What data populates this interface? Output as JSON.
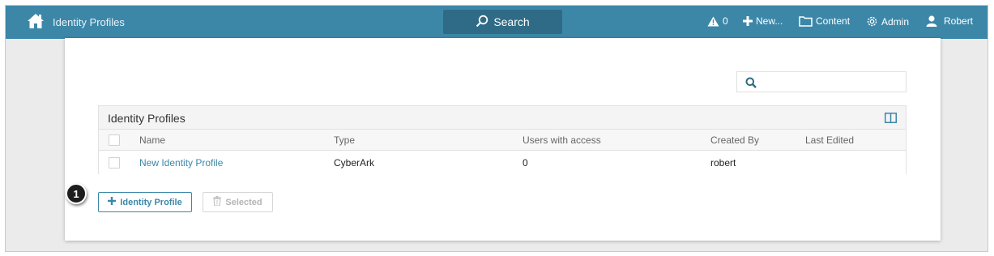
{
  "topbar": {
    "app_title": "Identity Profiles",
    "search_label": "Search",
    "alerts_count": "0",
    "new_label": "New...",
    "content_label": "Content",
    "admin_label": "Admin",
    "user_label": "Robert",
    "bg_color": "#3c87a8",
    "search_bg_color": "#2f6b86"
  },
  "search": {
    "value": "",
    "placeholder": ""
  },
  "grid": {
    "title": "Identity Profiles",
    "columns": [
      "Name",
      "Type",
      "Users with access",
      "Created By",
      "Last Edited"
    ],
    "rows": [
      {
        "name": "New Identity Profile",
        "type": "CyberArk",
        "users_with_access": "0",
        "created_by": "robert",
        "last_edited": ""
      }
    ]
  },
  "actions": {
    "add_label": "Identity Profile",
    "delete_label": "Selected"
  },
  "callout": {
    "number": "1"
  },
  "icons": [
    "home-icon",
    "search-icon",
    "warning-icon",
    "plus-icon",
    "content-icon",
    "gear-icon",
    "user-icon",
    "columns-icon",
    "trash-icon"
  ]
}
